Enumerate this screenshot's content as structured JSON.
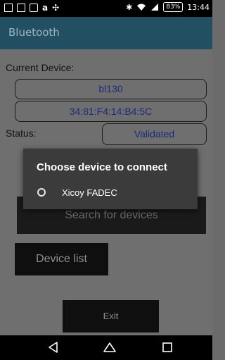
{
  "status_bar": {
    "time": "13:44",
    "battery": "83%"
  },
  "app_bar": {
    "title": "Bluetooth"
  },
  "device_info": {
    "current_device_label": "Current Device:",
    "device_name": "bl130",
    "device_address": "34:81:F4:14:B4:5C",
    "status_label": "Status:",
    "status_value": "Validated"
  },
  "buttons": {
    "search_label": "Search for devices",
    "device_list_label": "Device list",
    "exit_label": "Exit"
  },
  "dialog": {
    "title": "Choose device to connect",
    "options": [
      {
        "label": "Xicoy FADEC",
        "selected": false
      }
    ]
  },
  "icons": {
    "status_left": [
      "image-icon",
      "screen-icon",
      "mail-icon",
      "app-a-icon",
      "app-tools-icon"
    ],
    "status_right": [
      "bluetooth-icon",
      "wifi-icon",
      "signal-icon"
    ],
    "nav": [
      "back-icon",
      "home-icon",
      "recents-icon"
    ]
  },
  "colors": {
    "app_bar": "#234f62",
    "app_bar_text": "#9fb6c2",
    "pill_text": "#1e2a7a",
    "dialog_bg": "#3b3b3b"
  }
}
